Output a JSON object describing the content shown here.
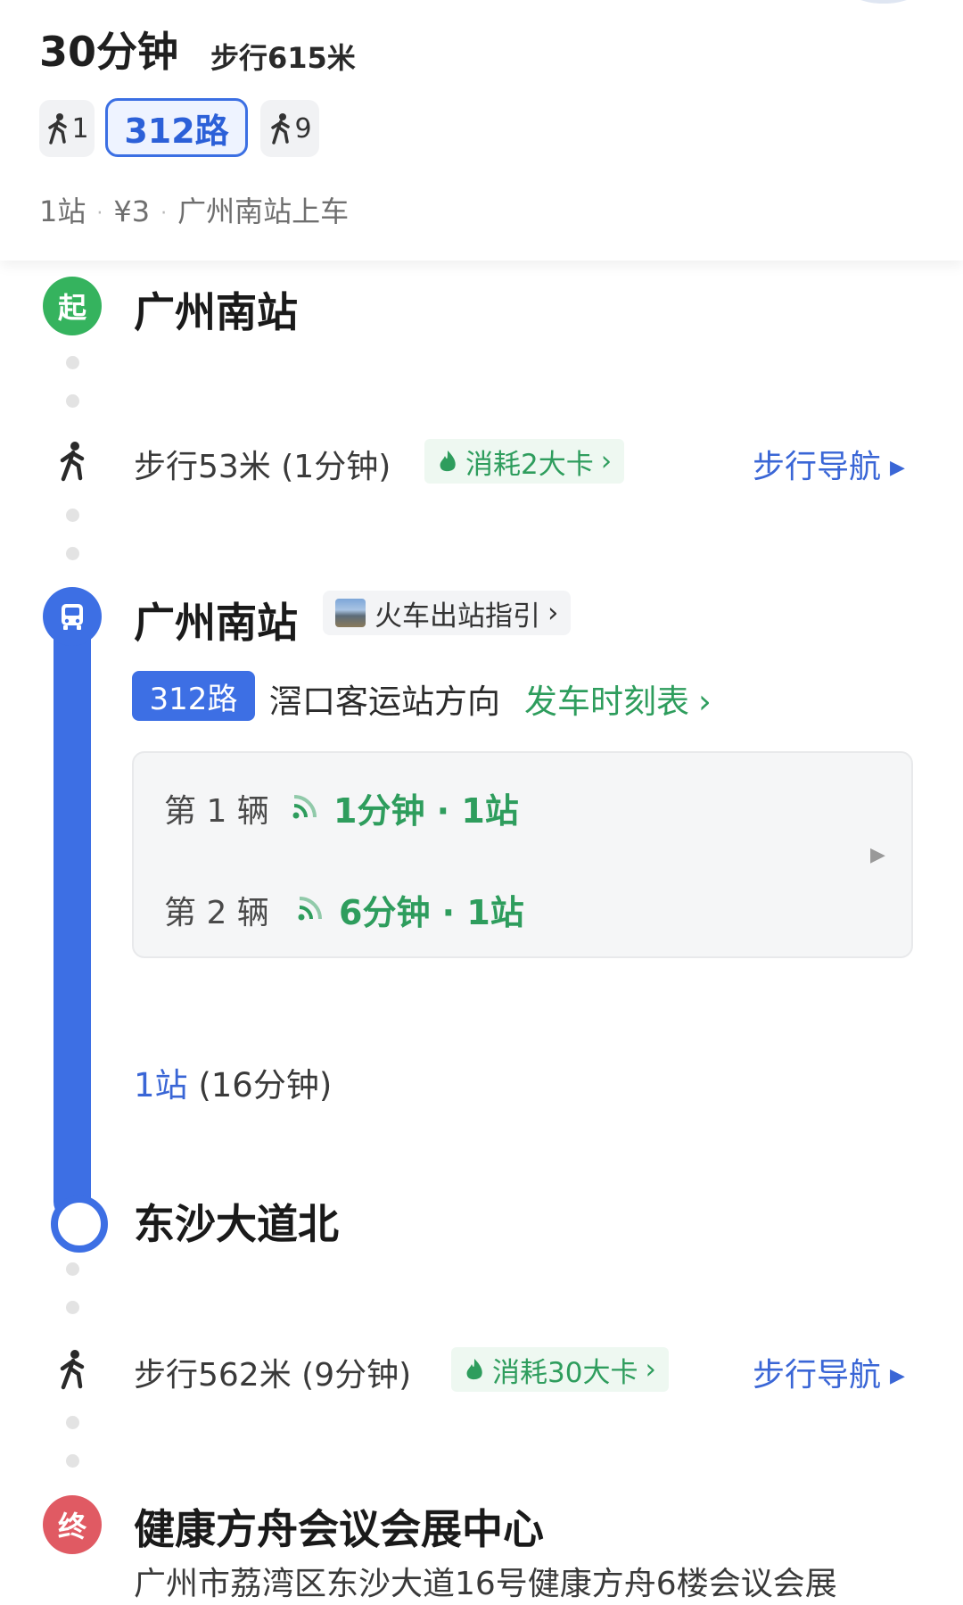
{
  "header": {
    "duration": "30分钟",
    "walk_total": "步行615米",
    "segments": [
      {
        "label": "1",
        "icon": "walk-icon"
      },
      {
        "label": "312路"
      },
      {
        "label": "9",
        "icon": "walk-icon"
      }
    ],
    "summary": {
      "stops": "1站",
      "fare": "¥3",
      "board": "广州南站上车",
      "separator": "·"
    }
  },
  "timeline": {
    "start_badge": "起",
    "start_station": "广州南站",
    "walk1": {
      "text": "步行53米 (1分钟)",
      "calories": "消耗2大卡",
      "chevron": "›",
      "nav": "步行导航",
      "nav_arrow": "▶"
    },
    "bus": {
      "station": "广州南站",
      "guide": "火车出站指引",
      "guide_chevron": "›",
      "route": "312路",
      "direction": "滘口客运站方向",
      "timetable": "发车时刻表",
      "timetable_chevron": "›",
      "arrivals": [
        {
          "label": "第 1 辆",
          "eta": "1分钟 · 1站"
        },
        {
          "label": "第 2 辆",
          "eta": "6分钟 · 1站"
        }
      ],
      "arrivals_chevron": "▶",
      "stops_count": "1站",
      "stops_duration": "(16分钟)",
      "alight_station": "东沙大道北"
    },
    "walk2": {
      "text": "步行562米 (9分钟)",
      "calories": "消耗30大卡",
      "chevron": "›",
      "nav": "步行导航",
      "nav_arrow": "▶"
    },
    "end_badge": "终",
    "destination": "健康方舟会议会展中心",
    "destination_address": "广州市荔湾区东沙大道16号健康方舟6楼会议会展"
  },
  "colors": {
    "accent_blue": "#3d6fe4",
    "green": "#2e9d5d",
    "start_green": "#35b35e",
    "end_red": "#e05a63"
  }
}
